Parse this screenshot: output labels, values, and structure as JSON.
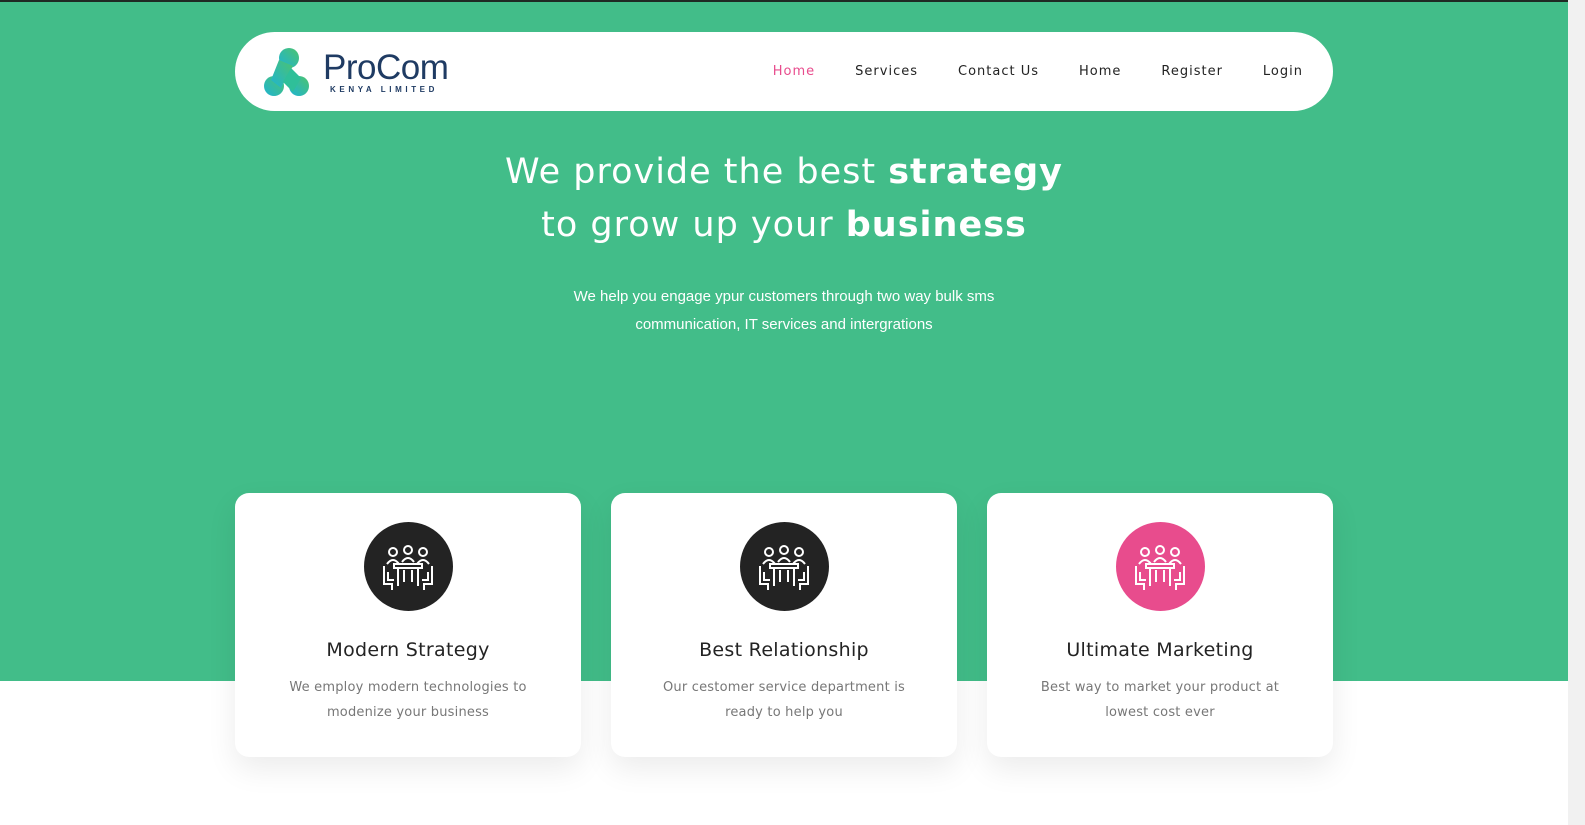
{
  "brand": {
    "name": "ProCom",
    "tagline": "KENYA LIMITED",
    "colors": {
      "dark": "#1f3b63",
      "teal": "#23b9c9",
      "green": "#46c07a"
    }
  },
  "nav": {
    "items": [
      {
        "label": "Home",
        "active": true
      },
      {
        "label": "Services",
        "active": false
      },
      {
        "label": "Contact Us",
        "active": false
      },
      {
        "label": "Home",
        "active": false
      },
      {
        "label": "Register",
        "active": false
      },
      {
        "label": "Login",
        "active": false
      }
    ]
  },
  "hero": {
    "line1_prefix": "We provide the best ",
    "line1_bold": "strategy",
    "line2_prefix": "to grow up your ",
    "line2_bold": "business",
    "subtext": "We help you engage ypur customers through two way bulk sms communication, IT services and intergrations"
  },
  "cards": [
    {
      "icon": "meeting-icon",
      "icon_bg": "#232323",
      "title": "Modern Strategy",
      "desc": "We employ modern technologies to modenize your business"
    },
    {
      "icon": "meeting-icon",
      "icon_bg": "#232323",
      "title": "Best Relationship",
      "desc": "Our cestomer service department is ready to help you"
    },
    {
      "icon": "meeting-icon",
      "icon_bg": "#e84c8d",
      "title": "Ultimate Marketing",
      "desc": "Best way to market your product at lowest cost ever"
    }
  ],
  "theme": {
    "hero_bg": "#42bd89",
    "accent": "#e84c8d"
  }
}
